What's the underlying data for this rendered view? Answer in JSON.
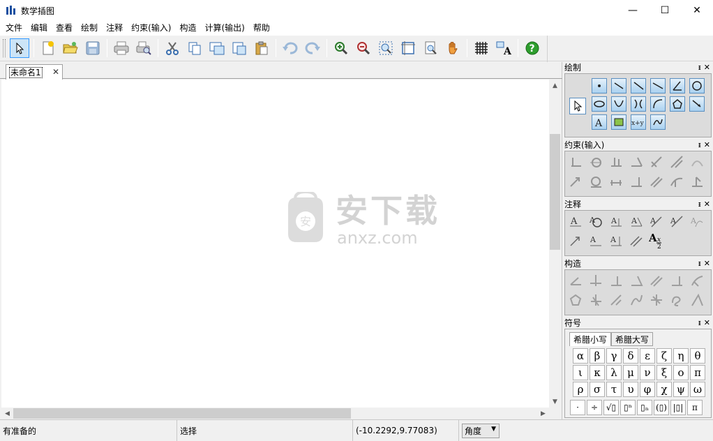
{
  "window": {
    "title": "数学插图",
    "minimize": "—",
    "maximize": "☐",
    "close": "✕"
  },
  "menu": [
    "文件",
    "编辑",
    "查看",
    "绘制",
    "注释",
    "约束(输入)",
    "构造",
    "计算(输出)",
    "帮助"
  ],
  "toolbar": {
    "icons": [
      "select-arrow",
      "new",
      "open",
      "save",
      "print",
      "print-preview",
      "cut",
      "copy",
      "copy-special",
      "paste-special",
      "paste",
      "undo",
      "redo",
      "zoom-in",
      "zoom-out",
      "zoom-window",
      "zoom-fit",
      "zoom-page",
      "pan-hand",
      "grid",
      "text-style",
      "help"
    ]
  },
  "document": {
    "tab_label": "未命名1",
    "tab_close": "✕"
  },
  "watermark": {
    "title": "安下载",
    "domain": "anxz.com"
  },
  "panels": {
    "draw": {
      "title": "绘制",
      "pin": "ᵻ",
      "close": "✕"
    },
    "constraint": {
      "title": "约束(输入)",
      "pin": "ᵻ",
      "close": "✕"
    },
    "annotation": {
      "title": "注释",
      "pin": "ᵻ",
      "close": "✕",
      "formula_a": "A",
      "formula_x": "x",
      "formula_2": "2"
    },
    "construct": {
      "title": "构造",
      "pin": "ᵻ",
      "close": "✕"
    },
    "symbols": {
      "title": "符号",
      "pin": "ᵻ",
      "close": "✕",
      "tab_lower": "希腊小写",
      "tab_upper": "希腊大写",
      "greek": [
        "α",
        "β",
        "γ",
        "δ",
        "ε",
        "ζ",
        "η",
        "θ",
        "ι",
        "κ",
        "λ",
        "μ",
        "ν",
        "ξ",
        "ο",
        "π",
        "ρ",
        "σ",
        "τ",
        "υ",
        "φ",
        "χ",
        "ψ",
        "ω"
      ],
      "ops": [
        "·",
        "÷",
        "√▯",
        "▯ⁿ",
        "▯ₙ",
        "(▯)",
        "|▯|",
        "π"
      ]
    }
  },
  "status": {
    "ready": "有准备的",
    "mode": "选择",
    "coords": "(-10.2292,9.77083)",
    "unit": "角度"
  },
  "colors": {
    "accent": "#3399ff",
    "help_green": "#2e9e2e",
    "panel_blue": "#a9d1f0"
  }
}
